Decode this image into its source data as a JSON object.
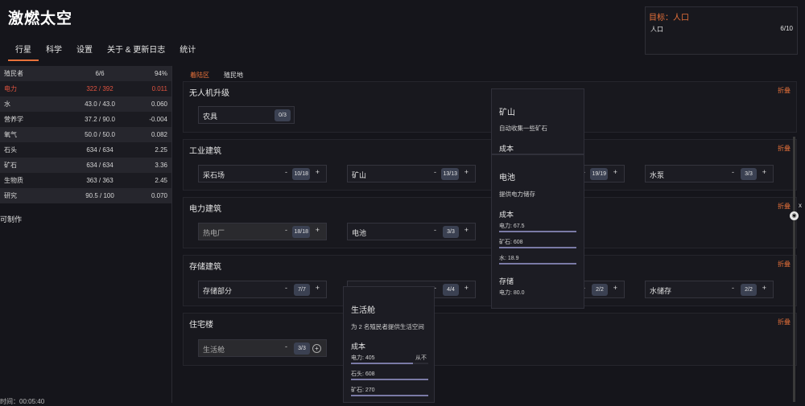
{
  "app": {
    "title": "激燃太空"
  },
  "tabs": [
    "行星",
    "科学",
    "设置",
    "关于 & 更新日志",
    "统计"
  ],
  "goal": {
    "title": "目标：人口",
    "label": "人口",
    "value": "6/10"
  },
  "resources": [
    {
      "name": "殖民者",
      "amount": "6/6",
      "rate": "94%"
    },
    {
      "name": "电力",
      "amount": "322 / 392",
      "rate": "0.011"
    },
    {
      "name": "水",
      "amount": "43.0 / 43.0",
      "rate": "0.060"
    },
    {
      "name": "营养学",
      "amount": "37.2 / 90.0",
      "rate": "-0.004"
    },
    {
      "name": "氧气",
      "amount": "50.0 / 50.0",
      "rate": "0.082"
    },
    {
      "name": "石头",
      "amount": "634 / 634",
      "rate": "2.25"
    },
    {
      "name": "矿石",
      "amount": "634 / 634",
      "rate": "3.36"
    },
    {
      "name": "生物质",
      "amount": "363 / 363",
      "rate": "2.45"
    },
    {
      "name": "研究",
      "amount": "90.5 / 100",
      "rate": "0.070"
    }
  ],
  "craftable_label": "可制作",
  "time_text": "时间：00:05:40",
  "subtabs": [
    "着陆区",
    "殖民地"
  ],
  "fold_label": "折叠",
  "sections": [
    {
      "title": "无人机升级",
      "buildings": [
        {
          "name": "农具",
          "count": "0/3"
        }
      ]
    },
    {
      "title": "工业建筑",
      "buildings": [
        {
          "name": "采石场",
          "count": "10/18"
        },
        {
          "name": "矿山",
          "count": "13/13"
        },
        {
          "name": "",
          "count": "19/19"
        },
        {
          "name": "水泵",
          "count": "3/3"
        }
      ]
    },
    {
      "title": "电力建筑",
      "buildings": [
        {
          "name": "热电厂",
          "count": "18/18"
        },
        {
          "name": "电池",
          "count": "3/3"
        }
      ]
    },
    {
      "title": "存储建筑",
      "buildings": [
        {
          "name": "存储部分",
          "count": "7/7"
        },
        {
          "name": "",
          "count": "4/4"
        },
        {
          "name": "",
          "count": "2/2"
        },
        {
          "name": "水储存",
          "count": "2/2"
        }
      ]
    },
    {
      "title": "住宅楼",
      "buildings": [
        {
          "name": "生活舱",
          "count": "3/3"
        }
      ]
    }
  ],
  "tooltip_mine": {
    "title": "矿山",
    "desc": "自动收集一些矿石",
    "cost_label": "成本"
  },
  "tooltip_battery": {
    "title": "电池",
    "desc": "提供电力储存",
    "cost_label": "成本",
    "costs": [
      {
        "label": "电力: 67.5",
        "fill": 1.0
      },
      {
        "label": "矿石: 608",
        "fill": 1.0
      },
      {
        "label": "水: 18.9",
        "fill": 1.0
      }
    ],
    "storage_label": "存储",
    "storage_value": "电力: 80.0"
  },
  "tooltip_habitat": {
    "title": "生活舱",
    "desc": "为 2 名殖民者提供生活空间",
    "cost_label": "成本",
    "costs": [
      {
        "label": "电力: 405",
        "extra": "从不",
        "fill": 0.8
      },
      {
        "label": "石头: 608",
        "fill": 1.0
      },
      {
        "label": "矿石: 270",
        "fill": 1.0
      }
    ]
  },
  "colors": {
    "accent": "#e8713a",
    "warning": "#e0533f",
    "background": "#15151b"
  },
  "icons": {
    "close": "close-icon",
    "github": "github-icon"
  }
}
